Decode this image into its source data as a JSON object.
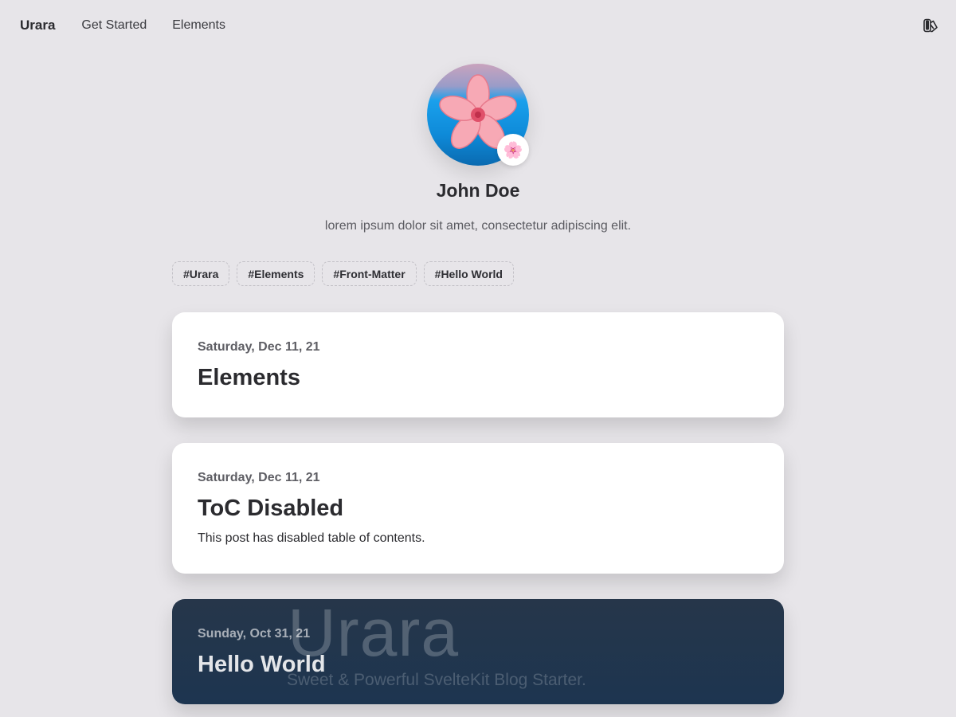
{
  "nav": {
    "brand": "Urara",
    "links": [
      "Get Started",
      "Elements"
    ],
    "theme_icon": "theme-toggle-icon"
  },
  "profile": {
    "avatar_icon": "cherry-blossom-icon",
    "badge_emoji": "🌸",
    "name": "John Doe",
    "bio": "lorem ipsum dolor sit amet, consectetur adipiscing elit."
  },
  "tags": [
    "#Urara",
    "#Elements",
    "#Front-Matter",
    "#Hello World"
  ],
  "posts": [
    {
      "date": "Saturday, Dec 11, 21",
      "title": "Elements",
      "excerpt": ""
    },
    {
      "date": "Saturday, Dec 11, 21",
      "title": "ToC Disabled",
      "excerpt": "This post has disabled table of contents."
    },
    {
      "date": "Sunday, Oct 31, 21",
      "title": "Hello World",
      "excerpt": "",
      "cover_title": "Urara",
      "cover_subtitle": "Sweet & Powerful SvelteKit Blog Starter."
    }
  ],
  "colors": {
    "background": "#e7e5e9",
    "card": "#ffffff",
    "dark_card": "#26364a"
  }
}
